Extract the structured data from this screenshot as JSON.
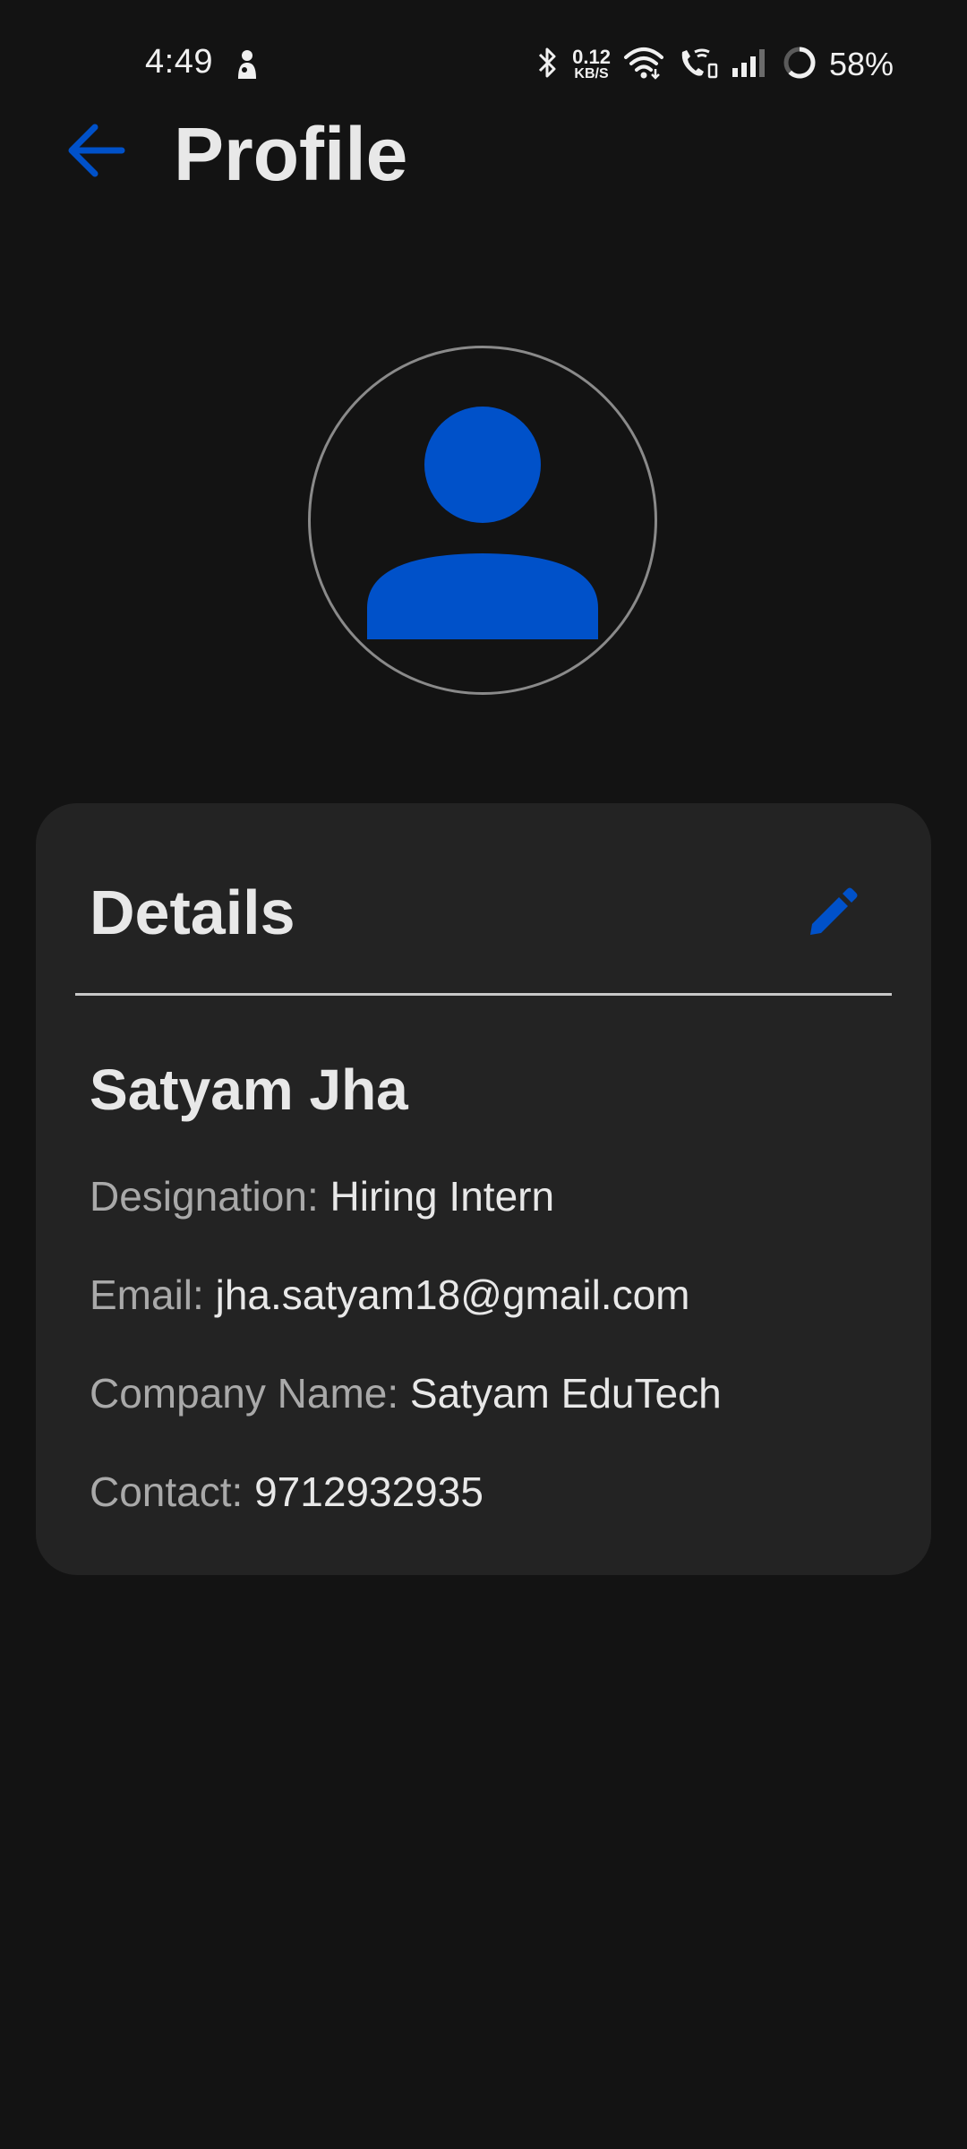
{
  "status_bar": {
    "time": "4:49",
    "left_icon": "notification-icon",
    "net_speed_value": "0.12",
    "net_speed_unit": "KB/S",
    "icons": [
      "bluetooth-icon",
      "wifi-icon",
      "wifi-calling-icon",
      "signal-icon",
      "battery-icon"
    ],
    "battery_percent": "58%"
  },
  "app_bar": {
    "back_icon": "arrow-left-icon",
    "title": "Profile"
  },
  "avatar": {
    "icon": "person-icon"
  },
  "details": {
    "title": "Details",
    "edit_icon": "pencil-icon",
    "name": "Satyam Jha",
    "fields": [
      {
        "label": "Designation:",
        "value": "Hiring Intern"
      },
      {
        "label": "Email:",
        "value": "jha.satyam18@gmail.com"
      },
      {
        "label": "Company Name:",
        "value": "Satyam EduTech"
      },
      {
        "label": "Contact:",
        "value": "9712932935"
      }
    ]
  },
  "colors": {
    "background": "#131313",
    "card": "#232323",
    "accent": "#0051c9",
    "text_primary": "#e8e8e8",
    "text_label": "#a9a9a9"
  }
}
